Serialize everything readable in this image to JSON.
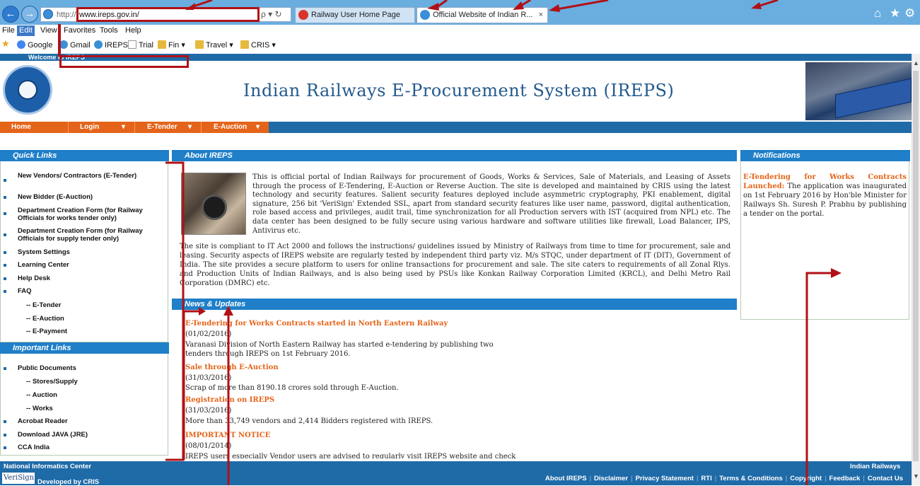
{
  "browser": {
    "address_proto": "http://",
    "address_url": "www.ireps.gov.in/",
    "address_tools": "ρ ▾ ↻",
    "back_glyph": "←",
    "forward_glyph": "→",
    "tabs": [
      {
        "label": "Railway User Home Page"
      },
      {
        "label": "Official Website of Indian R...",
        "close": "×"
      }
    ],
    "home_glyph": "⌂",
    "star_glyph": "★",
    "gear_glyph": "⚙"
  },
  "menubar": {
    "items": [
      "File",
      "Edit",
      "View",
      "Favorites",
      "Tools",
      "Help"
    ]
  },
  "favbar": {
    "items": [
      "Google",
      "Gmail",
      "IREPS",
      "Trial",
      "Fin ▾",
      "Travel ▾",
      "CRIS ▾"
    ]
  },
  "page": {
    "welcome": "Welcome to IREPS",
    "title": "Indian Railways E-Procurement System (IREPS)",
    "nav": [
      "Home",
      "Login",
      "E-Tender",
      "E-Auction"
    ],
    "nav_caret": "▾"
  },
  "quick_links": {
    "heading": "Quick Links",
    "items": [
      "New Vendors/ Contractors (E-Tender)",
      "New Bidder (E-Auction)",
      "Department Creation Form (for Railway Officials for works tender only)",
      "Department Creation Form (for Railway Officials for supply tender only)",
      "System Settings",
      "Learning Center",
      "Help Desk",
      "FAQ"
    ],
    "sub_items": [
      "-- E-Tender",
      "-- E-Auction",
      "-- E-Payment"
    ]
  },
  "important_links": {
    "heading": "Important Links",
    "items": [
      "Public Documents",
      "Acrobat Reader",
      "Download JAVA (JRE)",
      "CCA India"
    ],
    "sub_items": [
      "-- Stores/Supply",
      "-- Auction",
      "-- Works"
    ]
  },
  "about": {
    "heading": "About IREPS",
    "para1": "This is official portal of Indian Railways for procurement of Goods, Works & Services, Sale of Materials, and Leasing of Assets through the process of E-Tendering, E-Auction or Reverse Auction. The site is developed and maintained by CRIS using the latest technology and security features. Salient security features deployed include asymmetric cryptography, PKI enablement, digital signature, 256 bit 'VeriSign' Extended SSL, apart from standard security features like user name, password, digital authentication, role based access and privileges, audit trail, time synchronization for all Production servers with IST (acquired from NPL) etc. The data center has been designed to be fully secure using various hardware and software utilities like firewall, Load Balancer, IPS, Antivirus etc.",
    "para2": "The site is compliant to IT Act 2000 and follows the instructions/ guidelines issued by Ministry of Railways from time to time for procurement, sale and leasing. Security aspects of IREPS website are regularly tested by independent third party viz. M/s STQC, under department of IT (DIT), Government of India. The site provides a secure platform to users for online transactions for procurement and sale. The site caters to requirements of all Zonal Rlys. and Production Units of Indian Railways, and is also being used by PSUs like Konkan Railway Corporation Limited (KRCL), and Delhi Metro Rail Corporation (DMRC) etc."
  },
  "news": {
    "heading": "News & Updates",
    "items": [
      {
        "title": "E-Tendering for Works Contracts started in North Eastern Railway",
        "date": "(01/02/2016)",
        "body": "Varanasi Division of North Eastern Railway has started e-tendering by publishing two tenders through IREPS on 1st February 2016."
      },
      {
        "title": "Sale through E-Auction",
        "date": "(31/03/2016)",
        "body": "Scrap of more than 8190.18 crores sold through E-Auction."
      },
      {
        "title": "Registration on IREPS",
        "date": "(31/03/2016)",
        "body": "More than 33,749 vendors and 2,414 Bidders registered with IREPS."
      },
      {
        "title": "IMPORTANT NOTICE",
        "date": "(08/01/2014)",
        "body": "IREPS users especially Vendor users are advised to regularly visit IREPS website and check"
      }
    ]
  },
  "notifications": {
    "heading": "Notifications",
    "highlight": "E-Tendering for Works Contracts Launched:",
    "text": " The application was inaugurated on 1st February 2016 by Hon'ble Minister for Railways Sh. Suresh P. Prabhu by publishing a tender on the portal."
  },
  "footer": {
    "left": "National Informatics Center",
    "right": "Indian Railways",
    "verisign": "VeriSign",
    "developed_by": "Developed by CRIS",
    "links": [
      "About IREPS",
      "Disclaimer",
      "Privacy Statement",
      "RTI",
      "Terms & Conditions",
      "Copyright",
      "Feedback",
      "Contact Us"
    ]
  },
  "colors": {
    "header_blue": "#1f6ba8",
    "nav_orange": "#e4641a",
    "annotation_red": "#b11116"
  }
}
